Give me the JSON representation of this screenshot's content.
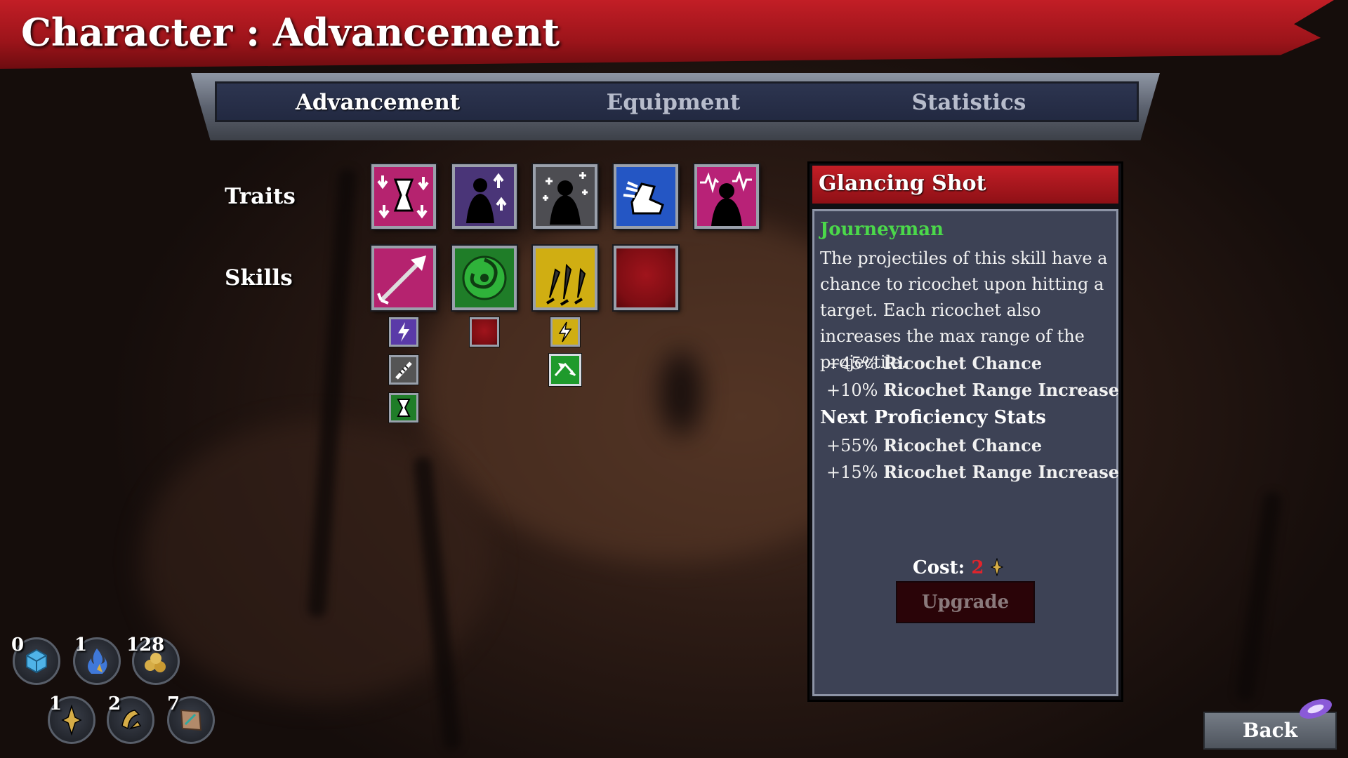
{
  "header": {
    "title": "Character : Advancement"
  },
  "tabs": [
    {
      "label": "Advancement",
      "active": true
    },
    {
      "label": "Equipment",
      "active": false
    },
    {
      "label": "Statistics",
      "active": false
    }
  ],
  "sections": {
    "traits_label": "Traits",
    "skills_label": "Skills"
  },
  "traits": [
    {
      "icon": "hourglass-down-arrows-icon",
      "color": "#b5236f"
    },
    {
      "icon": "silhouette-up-arrows-icon",
      "color": "#5b3a8a"
    },
    {
      "icon": "silhouette-sparkles-icon",
      "color": "#5c5c5c"
    },
    {
      "icon": "winged-boot-icon",
      "color": "#2a5fd0"
    },
    {
      "icon": "silhouette-pulse-icon",
      "color": "#c0287a"
    }
  ],
  "skills": [
    {
      "icon": "glancing-arrow-icon",
      "color": "#b5236f"
    },
    {
      "icon": "green-vortex-icon",
      "color": "#1f8a2a"
    },
    {
      "icon": "triple-daggers-icon",
      "color": "#d4b313"
    },
    {
      "icon": "empty-skill-slot",
      "color": "#8e1016"
    }
  ],
  "skill_mods": [
    [
      "lightning-bolt-icon",
      "spiked-rod-icon",
      "hourglass-icon"
    ],
    [
      "empty-mod-slot"
    ],
    [
      "lightning-bolt-gold-icon",
      "ricochet-arrows-icon"
    ]
  ],
  "detail": {
    "title": "Glancing Shot",
    "rank": "Journeyman",
    "description": "The projectiles of this skill have a chance to ricochet upon hitting a target. Each ricochet also increases the max range of the projectile.",
    "current_stats": [
      {
        "value": "+45%",
        "label": "Ricochet Chance"
      },
      {
        "value": "+10%",
        "label": "Ricochet  Range Increase"
      }
    ],
    "next_heading": "Next Proficiency Stats",
    "next_stats": [
      {
        "value": "+55%",
        "label": "Ricochet Chance"
      },
      {
        "value": "+15%",
        "label": "Ricochet  Range Increase"
      }
    ],
    "cost_label": "Cost:",
    "cost_value": "2",
    "upgrade_label": "Upgrade"
  },
  "resources": [
    {
      "icon": "crystal-cube-icon",
      "count": "0"
    },
    {
      "icon": "blue-flame-icon",
      "count": "1"
    },
    {
      "icon": "gold-nuggets-icon",
      "count": "128"
    },
    {
      "icon": "gold-star-shard-icon",
      "count": "1"
    },
    {
      "icon": "gold-rune-icon",
      "count": "2"
    },
    {
      "icon": "map-scroll-icon",
      "count": "7"
    }
  ],
  "back_label": "Back"
}
